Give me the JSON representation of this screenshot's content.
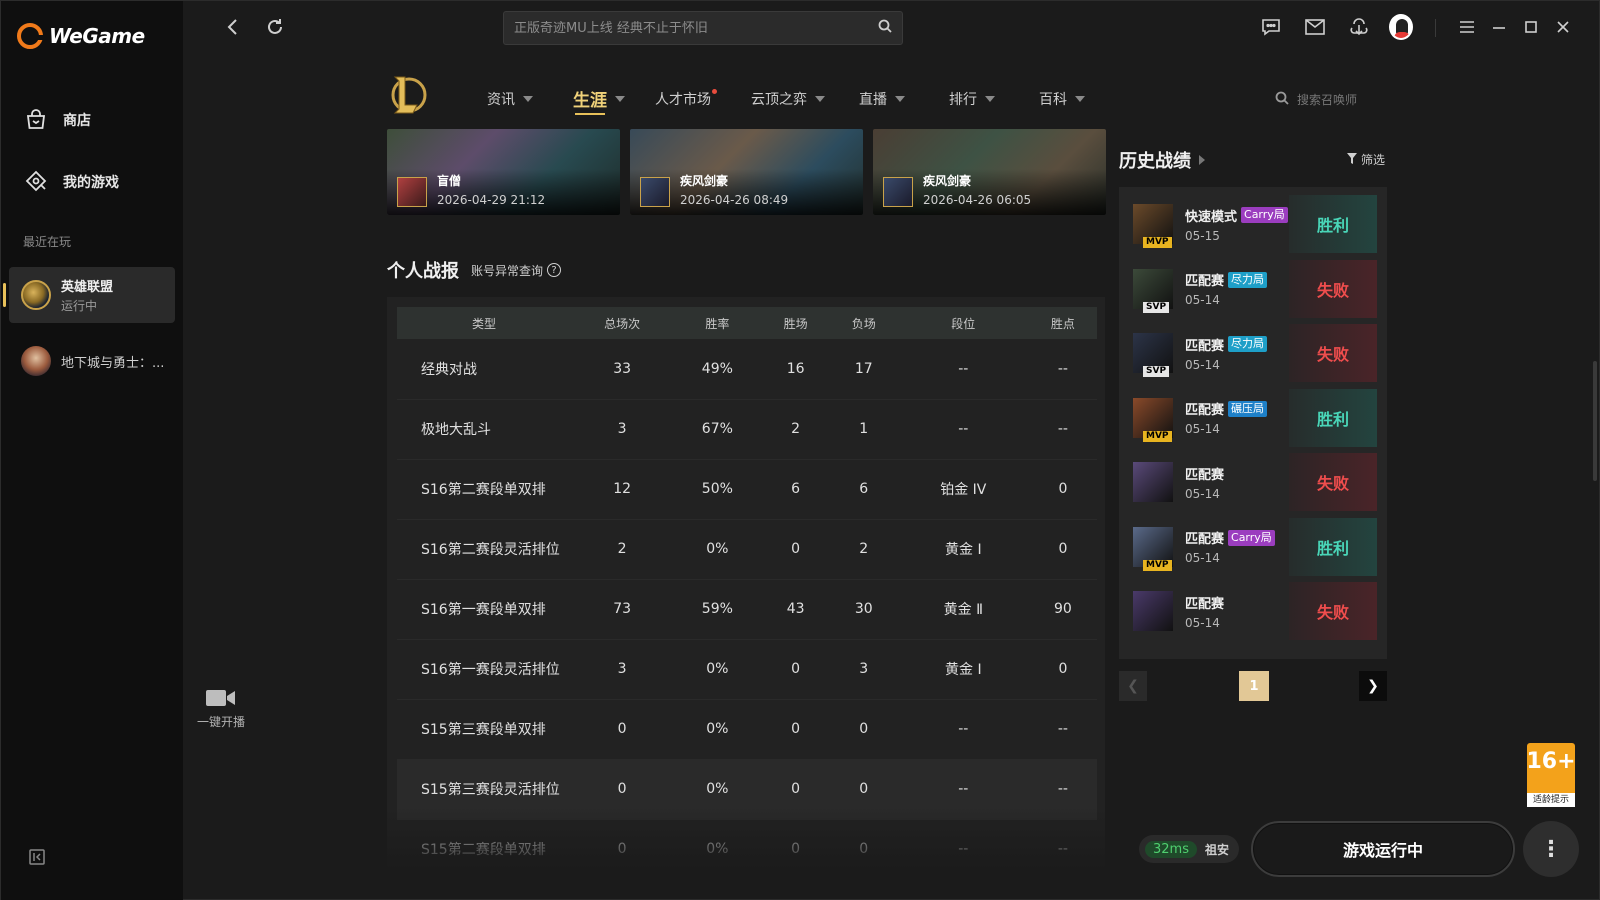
{
  "app": {
    "name": "WeGame"
  },
  "sidebar": {
    "items": [
      {
        "label": "商店",
        "icon": "store-icon"
      },
      {
        "label": "我的游戏",
        "icon": "gamepad-icon"
      }
    ],
    "recent_label": "最近在玩",
    "games": [
      {
        "name": "英雄联盟",
        "status": "运行中"
      },
      {
        "name": "地下城与勇士：..."
      }
    ],
    "broadcast_label": "一键开播"
  },
  "topbar": {
    "search_placeholder": "正版奇迹MU上线 经典不止于怀旧"
  },
  "game_nav": {
    "tabs": [
      {
        "label": "资讯"
      },
      {
        "label": "生涯"
      },
      {
        "label": "人才市场"
      },
      {
        "label": "云顶之弈"
      },
      {
        "label": "直播"
      },
      {
        "label": "排行"
      },
      {
        "label": "百科"
      }
    ],
    "summoner_search_placeholder": "搜索召唤师"
  },
  "recent_matches": [
    {
      "champion": "盲僧",
      "date": "2026-04-29 21:12"
    },
    {
      "champion": "疾风剑豪",
      "date": "2026-04-26 08:49"
    },
    {
      "champion": "疾风剑豪",
      "date": "2026-04-26 06:05"
    }
  ],
  "stats": {
    "title": "个人战报",
    "link": "账号异常查询",
    "help": "?",
    "headers": [
      "类型",
      "总场次",
      "胜率",
      "胜场",
      "负场",
      "段位",
      "胜点"
    ],
    "rows": [
      [
        "经典对战",
        "33",
        "49%",
        "16",
        "17",
        "--",
        "--"
      ],
      [
        "极地大乱斗",
        "3",
        "67%",
        "2",
        "1",
        "--",
        "--"
      ],
      [
        "S16第二赛段单双排",
        "12",
        "50%",
        "6",
        "6",
        "铂金 IV",
        "0"
      ],
      [
        "S16第二赛段灵活排位",
        "2",
        "0%",
        "0",
        "2",
        "黄金 Ⅰ",
        "0"
      ],
      [
        "S16第一赛段单双排",
        "73",
        "59%",
        "43",
        "30",
        "黄金 Ⅱ",
        "90"
      ],
      [
        "S16第一赛段灵活排位",
        "3",
        "0%",
        "0",
        "3",
        "黄金 Ⅰ",
        "0"
      ],
      [
        "S15第三赛段单双排",
        "0",
        "0%",
        "0",
        "0",
        "--",
        "--"
      ],
      [
        "S15第三赛段灵活排位",
        "0",
        "0%",
        "0",
        "0",
        "--",
        "--"
      ],
      [
        "S15第二赛段单双排",
        "0",
        "0%",
        "0",
        "0",
        "--",
        "--"
      ]
    ]
  },
  "history": {
    "title": "历史战绩",
    "filter_label": "筛选",
    "matches": [
      {
        "mode": "快速模式",
        "tag": "Carry局",
        "tag_type": "carry",
        "badge": "MVP",
        "date": "05-15",
        "result": "胜利",
        "win": true,
        "face": "#6b4a2a"
      },
      {
        "mode": "匹配赛",
        "tag": "尽力局",
        "tag_type": "tryhard",
        "badge": "SVP",
        "date": "05-14",
        "result": "失败",
        "win": false,
        "face": "#3c4a3a"
      },
      {
        "mode": "匹配赛",
        "tag": "尽力局",
        "tag_type": "tryhard",
        "badge": "SVP",
        "date": "05-14",
        "result": "失败",
        "win": false,
        "face": "#2c3448"
      },
      {
        "mode": "匹配赛",
        "tag": "碾压局",
        "tag_type": "crush",
        "badge": "MVP",
        "date": "05-14",
        "result": "胜利",
        "win": true,
        "face": "#8a4a2a"
      },
      {
        "mode": "匹配赛",
        "tag": "",
        "tag_type": "",
        "badge": "",
        "date": "05-14",
        "result": "失败",
        "win": false,
        "face": "#5a4a7a"
      },
      {
        "mode": "匹配赛",
        "tag": "Carry局",
        "tag_type": "carry",
        "badge": "MVP",
        "date": "05-14",
        "result": "胜利",
        "win": true,
        "face": "#5a6a8a"
      },
      {
        "mode": "匹配赛",
        "tag": "",
        "tag_type": "",
        "badge": "",
        "date": "05-14",
        "result": "失败",
        "win": false,
        "face": "#4a3a6a"
      }
    ],
    "page": "1"
  },
  "age_rating": {
    "number": "16+",
    "label": "适龄提示"
  },
  "bottom": {
    "ping": "32ms",
    "server": "祖安",
    "running_label": "游戏运行中",
    "more": "⋮"
  }
}
